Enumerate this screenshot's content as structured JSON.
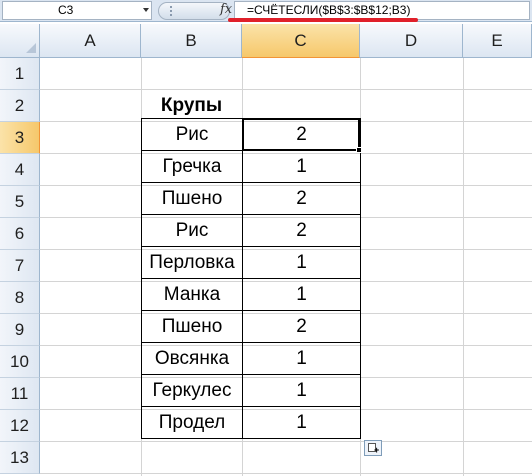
{
  "formula_bar": {
    "name_box": "C3",
    "fx_icon": "fx-icon",
    "formula": "=СЧЁТЕСЛИ($B$3:$B$12;B3)"
  },
  "columns": [
    "A",
    "B",
    "C",
    "D",
    "E"
  ],
  "rows": [
    "1",
    "2",
    "3",
    "4",
    "5",
    "6",
    "7",
    "8",
    "9",
    "10",
    "11",
    "12",
    "13"
  ],
  "active_cell": "C3",
  "table": {
    "header": "Крупы",
    "items": [
      {
        "name": "Рис",
        "count": "2"
      },
      {
        "name": "Гречка",
        "count": "1"
      },
      {
        "name": "Пшено",
        "count": "2"
      },
      {
        "name": "Рис",
        "count": "2"
      },
      {
        "name": "Перловка",
        "count": "1"
      },
      {
        "name": "Манка",
        "count": "1"
      },
      {
        "name": "Пшено",
        "count": "2"
      },
      {
        "name": "Овсянка",
        "count": "1"
      },
      {
        "name": "Геркулес",
        "count": "1"
      },
      {
        "name": "Продел",
        "count": "1"
      }
    ]
  },
  "colors": {
    "formula_highlight": "#e0202a",
    "active_header": "#f6c86b",
    "header_bg": "#dce6f2"
  }
}
